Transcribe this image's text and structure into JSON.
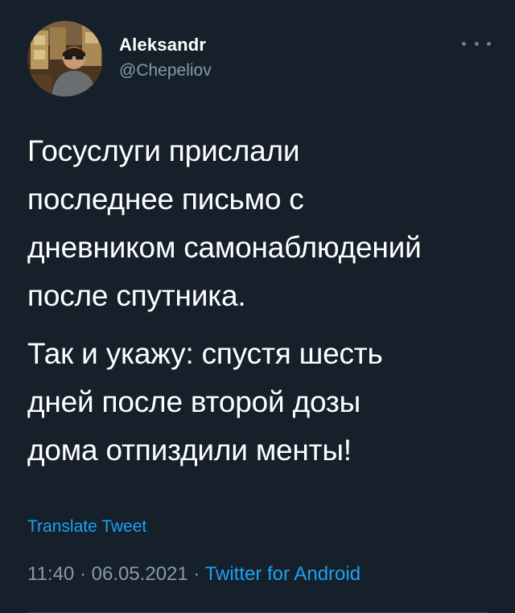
{
  "tweet": {
    "author": {
      "display_name": "Aleksandr",
      "handle": "@Chepeliov"
    },
    "menu_icon": "more-horizontal-icon",
    "paragraphs": [
      "Госуслуги прислали\nпоследнее письмо с\nдневником самонаблюдений\nпосле спутника.",
      "Так и укажу: спустя шесть\nдней после второй дозы\nдома отпиздили менты!"
    ],
    "translate_label": "Translate Tweet",
    "time": "11:40",
    "date": "06.05.2021",
    "separator": "·",
    "source_app": "Twitter for Android"
  },
  "colors": {
    "background": "#15202b",
    "text": "#ffffff",
    "secondary": "#8899a6",
    "accent": "#1da1f2",
    "divider": "#38444d"
  }
}
